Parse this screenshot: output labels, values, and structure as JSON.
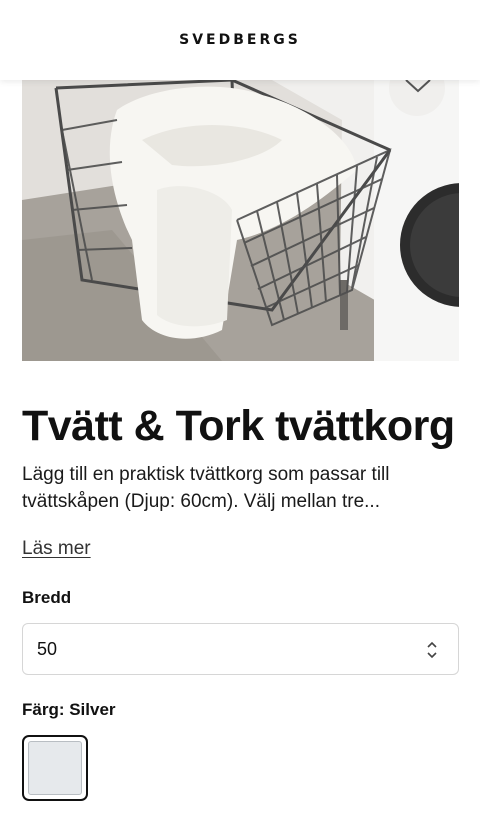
{
  "header": {
    "brand": "SVEDBERGS"
  },
  "product": {
    "title": "Tvätt & Tork tvättkorg",
    "description": "Lägg till en praktisk tvättkorg som passar till tvättskåpen (Djup: 60cm). Välj mellan tre...",
    "read_more": "Läs mer"
  },
  "options": {
    "width_label": "Bredd",
    "width_value": "50",
    "color_label": "Färg: Silver",
    "color_swatch": "#e6e9ec"
  },
  "icons": {
    "favorite": "heart-icon",
    "select": "chevron-up-down-icon"
  }
}
